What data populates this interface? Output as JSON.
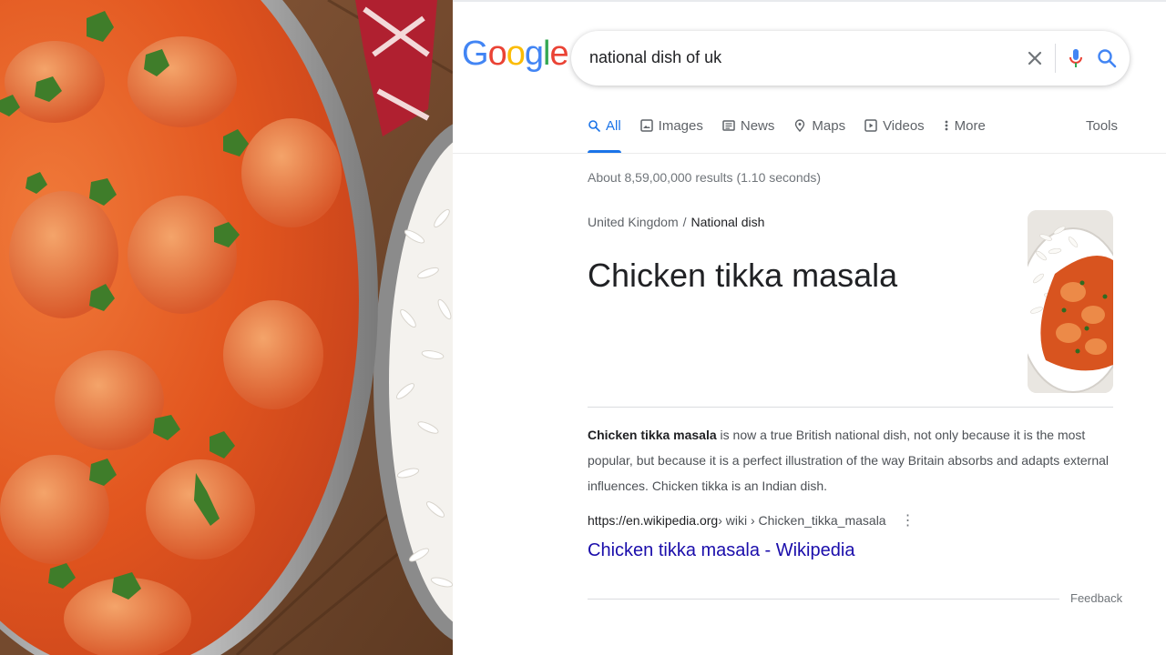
{
  "photo": {
    "icon": "chicken-tikka-masala-dish-photo"
  },
  "header": {
    "logo_letters": [
      {
        "ch": "G",
        "color": "#4285F4"
      },
      {
        "ch": "o",
        "color": "#EA4335"
      },
      {
        "ch": "o",
        "color": "#FBBC05"
      },
      {
        "ch": "g",
        "color": "#4285F4"
      },
      {
        "ch": "l",
        "color": "#34A853"
      },
      {
        "ch": "e",
        "color": "#EA4335"
      }
    ],
    "search": {
      "query": "national dish of uk"
    }
  },
  "tabs": [
    {
      "label": "All",
      "icon": "search-icon",
      "active": true
    },
    {
      "label": "Images",
      "icon": "image-icon"
    },
    {
      "label": "News",
      "icon": "news-icon"
    },
    {
      "label": "Maps",
      "icon": "map-pin-icon"
    },
    {
      "label": "Videos",
      "icon": "play-icon"
    },
    {
      "label": "More",
      "icon": "more-vert-icon"
    }
  ],
  "tools_label": "Tools",
  "result_stats": "About 8,59,00,000 results (1.10 seconds)",
  "breadcrumb": {
    "parent": "United Kingdom",
    "separator": "/",
    "current": "National dish"
  },
  "answer": "Chicken tikka masala",
  "snippet": {
    "bold": "Chicken tikka masala",
    "rest": " is now a true British national dish, not only because it is the most popular, but because it is a perfect illustration of the way Britain absorbs and adapts external influences. Chicken tikka is an Indian dish."
  },
  "source": {
    "domain": "https://en.wikipedia.org",
    "path": " › wiki › Chicken_tikka_masala",
    "menu_icon": "more-vert-icon",
    "link_title": "Chicken tikka masala - Wikipedia"
  },
  "feedback_label": "Feedback",
  "colors": {
    "accent": "#1a73e8",
    "link": "#1a0dab",
    "curry": "#e0561e"
  }
}
